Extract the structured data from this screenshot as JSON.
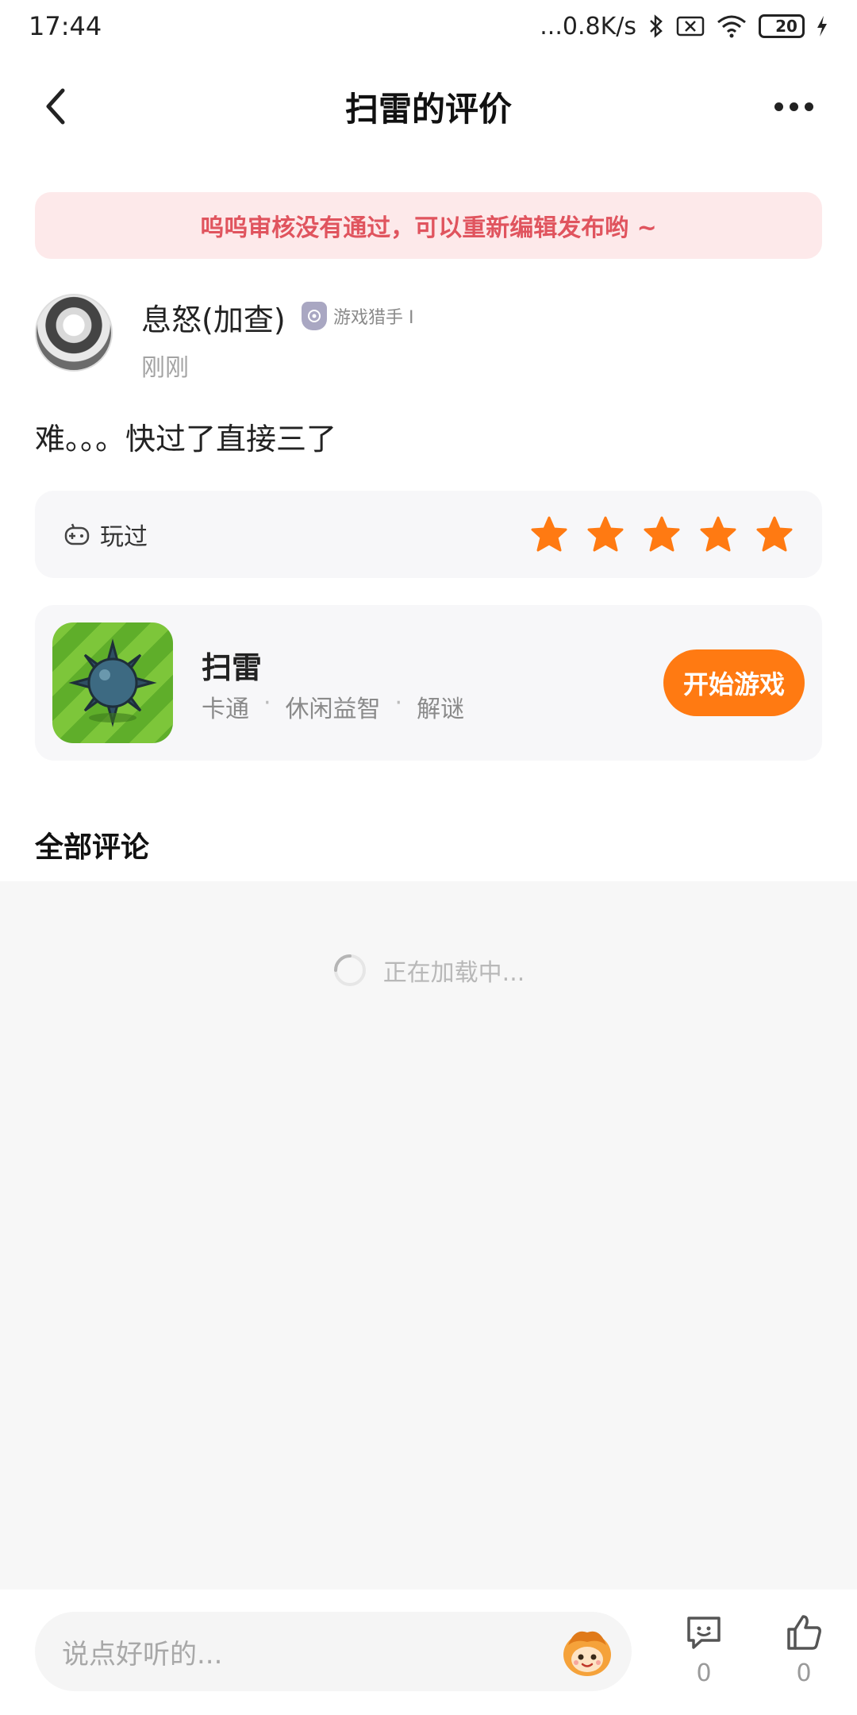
{
  "status_bar": {
    "time": "17:44",
    "network_speed": "...0.8K/s",
    "battery_level": "20",
    "icons": [
      "bluetooth-icon",
      "sim-off-icon",
      "wifi-icon",
      "battery-icon",
      "charging-icon"
    ]
  },
  "nav": {
    "title": "扫雷的评价",
    "back_icon": "chevron-left-icon",
    "more_icon": "more-dots-icon"
  },
  "notice": {
    "text": "呜呜审核没有通过，可以重新编辑发布哟 ~"
  },
  "review": {
    "username": "息怒(加查)",
    "badge_label": "游戏猎手 I",
    "time": "刚刚",
    "text": "难。。。快过了直接三了",
    "played_label": "玩过",
    "rating": 5,
    "rating_max": 5,
    "star_color": "#ff7a12"
  },
  "game": {
    "name": "扫雷",
    "tags": [
      "卡通",
      "休闲益智",
      "解谜"
    ],
    "tag_separator": "·",
    "start_label": "开始游戏",
    "accent_color": "#ff7a12"
  },
  "comments": {
    "section_title": "全部评论",
    "loading_text": "正在加载中..."
  },
  "bottom_bar": {
    "input_placeholder": "说点好听的...",
    "comment_count": "0",
    "like_count": "0"
  },
  "colors": {
    "notice_bg": "#fde9ea",
    "notice_text": "#e0545e",
    "card_bg": "#f7f7f9"
  }
}
